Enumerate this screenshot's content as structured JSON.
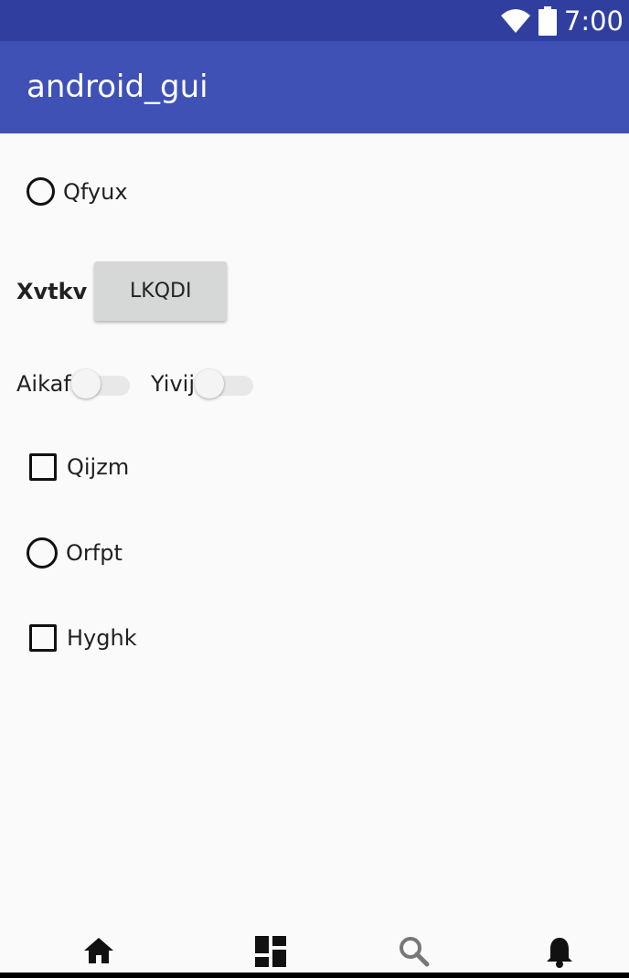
{
  "status_bar": {
    "time": "7:00",
    "icons": [
      "wifi-icon",
      "battery-icon"
    ],
    "background": "#303f9f"
  },
  "app_bar": {
    "title": "android_gui",
    "background": "#3f51b5"
  },
  "controls": {
    "radio_1": {
      "label": "Qfyux",
      "checked": false
    },
    "button_row": {
      "label": "Xvtkv",
      "button": "LKQDI"
    },
    "switch_1": {
      "label": "Aikaf",
      "on": false
    },
    "switch_2": {
      "label": "Yivij",
      "on": false
    },
    "checkbox_1": {
      "label": "Qijzm",
      "checked": false
    },
    "radio_2": {
      "label": "Orfpt",
      "checked": false
    },
    "checkbox_2": {
      "label": "Hyghk",
      "checked": false
    }
  },
  "bottom_nav": {
    "items": [
      "home-icon",
      "dashboard-icon",
      "search-icon",
      "notifications-icon"
    ],
    "active_color": "#111111",
    "inactive_color": "#777777"
  }
}
